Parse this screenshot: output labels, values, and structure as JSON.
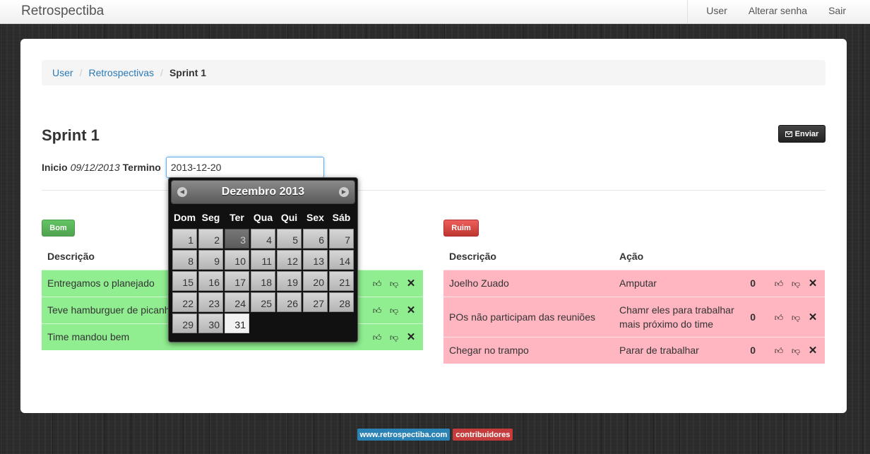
{
  "navbar": {
    "brand": "Retrospectiba",
    "links": [
      "User",
      "Alterar senha",
      "Sair"
    ]
  },
  "breadcrumb": {
    "items": [
      "User",
      "Retrospectivas"
    ],
    "active": "Sprint 1",
    "separator": "/"
  },
  "page": {
    "title": "Sprint 1",
    "send_button": "Enviar",
    "inicio_label": "Inicio",
    "inicio_value": "09/12/2013",
    "termino_label": "Termino",
    "termino_value": "2013-12-20"
  },
  "datepicker": {
    "title": "Dezembro 2013",
    "weekdays": [
      "Dom",
      "Seg",
      "Ter",
      "Qua",
      "Qui",
      "Sex",
      "Sáb"
    ],
    "days": [
      "1",
      "2",
      "3",
      "4",
      "5",
      "6",
      "7",
      "8",
      "9",
      "10",
      "11",
      "12",
      "13",
      "14",
      "15",
      "16",
      "17",
      "18",
      "19",
      "20",
      "21",
      "22",
      "23",
      "24",
      "25",
      "26",
      "27",
      "28",
      "29",
      "30",
      "31"
    ],
    "today": "3",
    "selected": "31"
  },
  "good": {
    "label": "Bom",
    "header_description": "Descrição",
    "items": [
      {
        "description": "Entregamos o planejado"
      },
      {
        "description": "Teve hamburguer de picanha"
      },
      {
        "description": "Time mandou bem"
      }
    ]
  },
  "bad": {
    "label": "Ruim",
    "header_description": "Descrição",
    "header_action": "Ação",
    "items": [
      {
        "description": "Joelho Zuado",
        "action": "Amputar",
        "votes": "0"
      },
      {
        "description": "POs não participam das reuniões",
        "action": "Chamr eles para trabalhar mais próximo do time",
        "votes": "0"
      },
      {
        "description": "Chegar no trampo",
        "action": "Parar de trabalhar",
        "votes": "0"
      }
    ]
  },
  "icons": {
    "like": "thumbs-up-icon",
    "dislike": "thumbs-down-icon",
    "delete": "close-icon",
    "send": "envelope-icon",
    "prev": "chevron-left-icon",
    "next": "chevron-right-icon"
  },
  "colors": {
    "good_row": "#90ee90",
    "bad_row": "#ffb6c1",
    "good_label": "#51a351",
    "bad_label": "#bd362f",
    "link": "#2a7ab8"
  },
  "footer": {
    "site": "www.retrospectiba.com",
    "contributors": "contribuidores"
  }
}
